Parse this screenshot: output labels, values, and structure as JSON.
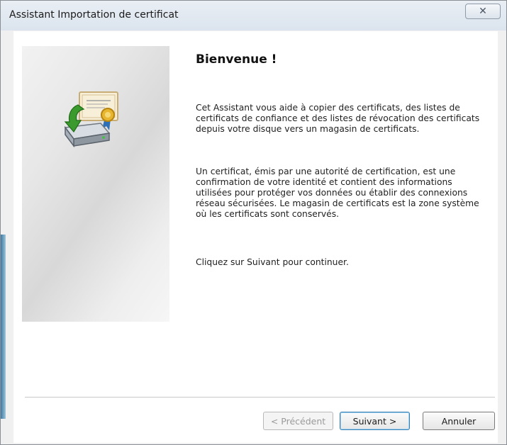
{
  "window": {
    "title": "Assistant Importation de certificat",
    "close_glyph": "✕"
  },
  "content": {
    "heading": "Bienvenue !",
    "paragraphs": [
      "Cet Assistant vous aide à copier des certificats, des listes de certificats de confiance et des listes de révocation des certificats depuis votre disque vers un magasin de certificats.",
      "Un certificat, émis par une autorité de certification, est une confirmation de votre identité et contient des informations utilisées pour protéger vos données ou établir des connexions réseau sécurisées. Le magasin de certificats est la zone système où les certificats sont conservés.",
      "Cliquez sur Suivant pour continuer."
    ],
    "icon": "certificate-import-icon"
  },
  "buttons": {
    "previous": "< Précédent",
    "next": "Suivant >",
    "cancel": "Annuler"
  },
  "colors": {
    "accent": "#3c7fb1",
    "disabled_text": "#9a9a9a",
    "arrow_green": "#3a9a2e"
  }
}
